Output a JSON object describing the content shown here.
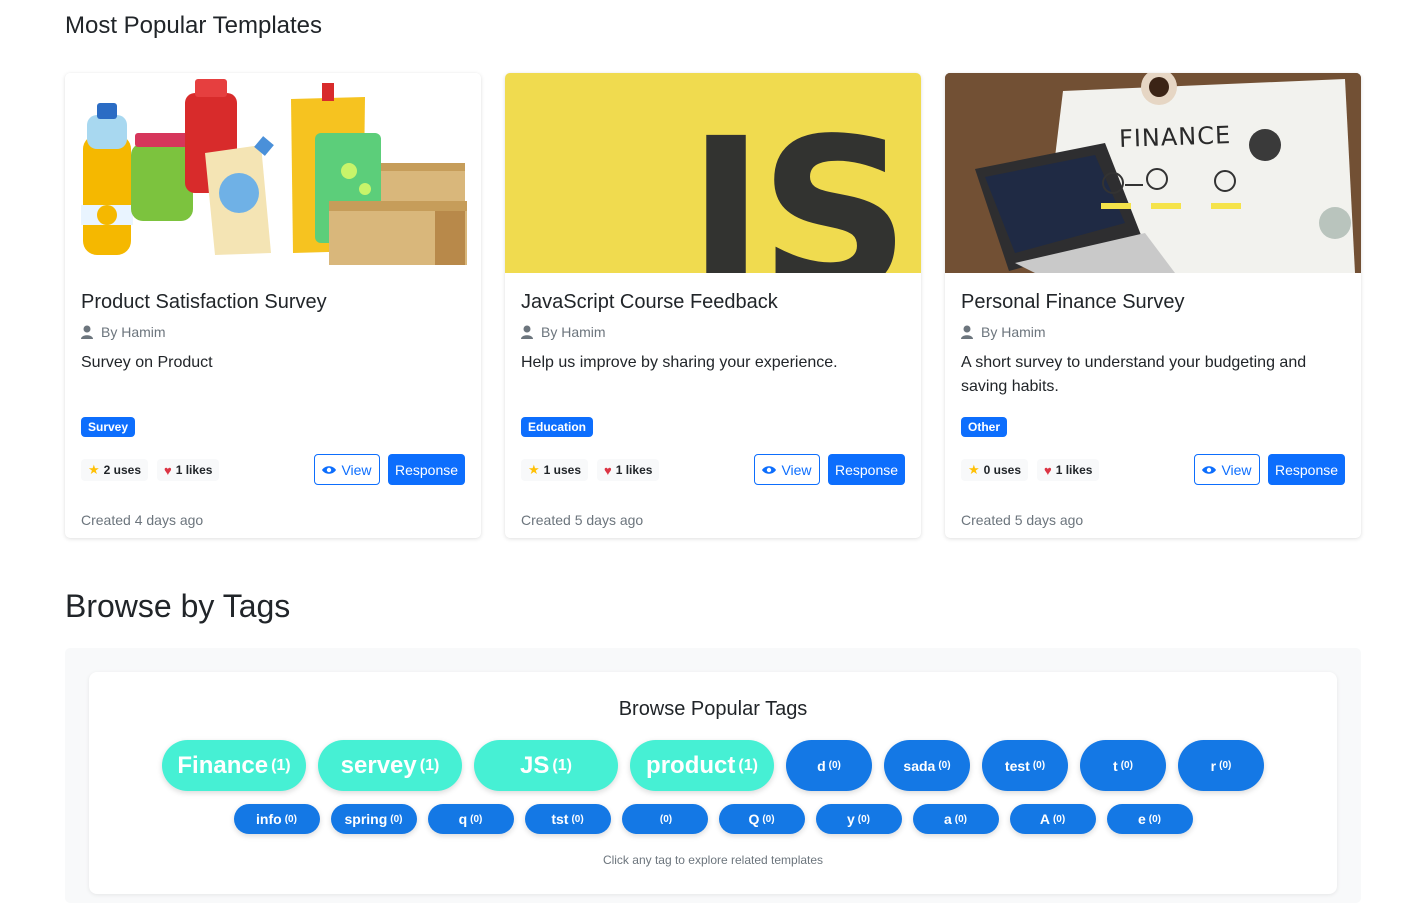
{
  "popular": {
    "title": "Most Popular Templates",
    "view_label": "View",
    "response_label": "Response",
    "cards": [
      {
        "title": "Product Satisfaction Survey",
        "author": "By Hamim",
        "description": "Survey on Product",
        "category": "Survey",
        "uses": "2 uses",
        "likes": "1 likes",
        "created": "Created 4 days ago",
        "image": "grocery-products-illustration"
      },
      {
        "title": "JavaScript Course Feedback",
        "author": "By Hamim",
        "description": "Help us improve by sharing your experience.",
        "category": "Education",
        "uses": "1 uses",
        "likes": "1 likes",
        "created": "Created 5 days ago",
        "image": "javascript-logo",
        "logo_text": "JS"
      },
      {
        "title": "Personal Finance Survey",
        "author": "By Hamim",
        "description": "A short survey to understand your budgeting and saving habits.",
        "category": "Other",
        "uses": "0 uses",
        "likes": "1 likes",
        "created": "Created 5 days ago",
        "image": "finance-desk-photo",
        "photo_text": "FINANCE"
      }
    ]
  },
  "tags_section": {
    "title": "Browse by Tags",
    "subtitle": "Browse Popular Tags",
    "hint": "Click any tag to explore related templates",
    "row1": [
      {
        "name": "Finance",
        "count": "(1)"
      },
      {
        "name": "servey",
        "count": "(1)"
      },
      {
        "name": "JS",
        "count": "(1)"
      },
      {
        "name": "product",
        "count": "(1)"
      },
      {
        "name": "d",
        "count": "(0)"
      },
      {
        "name": "sada",
        "count": "(0)"
      },
      {
        "name": "test",
        "count": "(0)"
      },
      {
        "name": "t",
        "count": "(0)"
      },
      {
        "name": "r",
        "count": "(0)"
      }
    ],
    "row2": [
      {
        "name": "info",
        "count": "(0)"
      },
      {
        "name": "spring",
        "count": "(0)"
      },
      {
        "name": "q",
        "count": "(0)"
      },
      {
        "name": "tst",
        "count": "(0)"
      },
      {
        "name": "",
        "count": "(0)"
      },
      {
        "name": "Q",
        "count": "(0)"
      },
      {
        "name": "y",
        "count": "(0)"
      },
      {
        "name": "a",
        "count": "(0)"
      },
      {
        "name": "A",
        "count": "(0)"
      },
      {
        "name": "e",
        "count": "(0)"
      }
    ]
  },
  "colors": {
    "primary": "#0d6efd",
    "popular_tag": "#46f0d4",
    "tag": "#1478e5",
    "js_yellow": "#f0db4f",
    "heart": "#dc3545",
    "star": "#ffc107"
  }
}
